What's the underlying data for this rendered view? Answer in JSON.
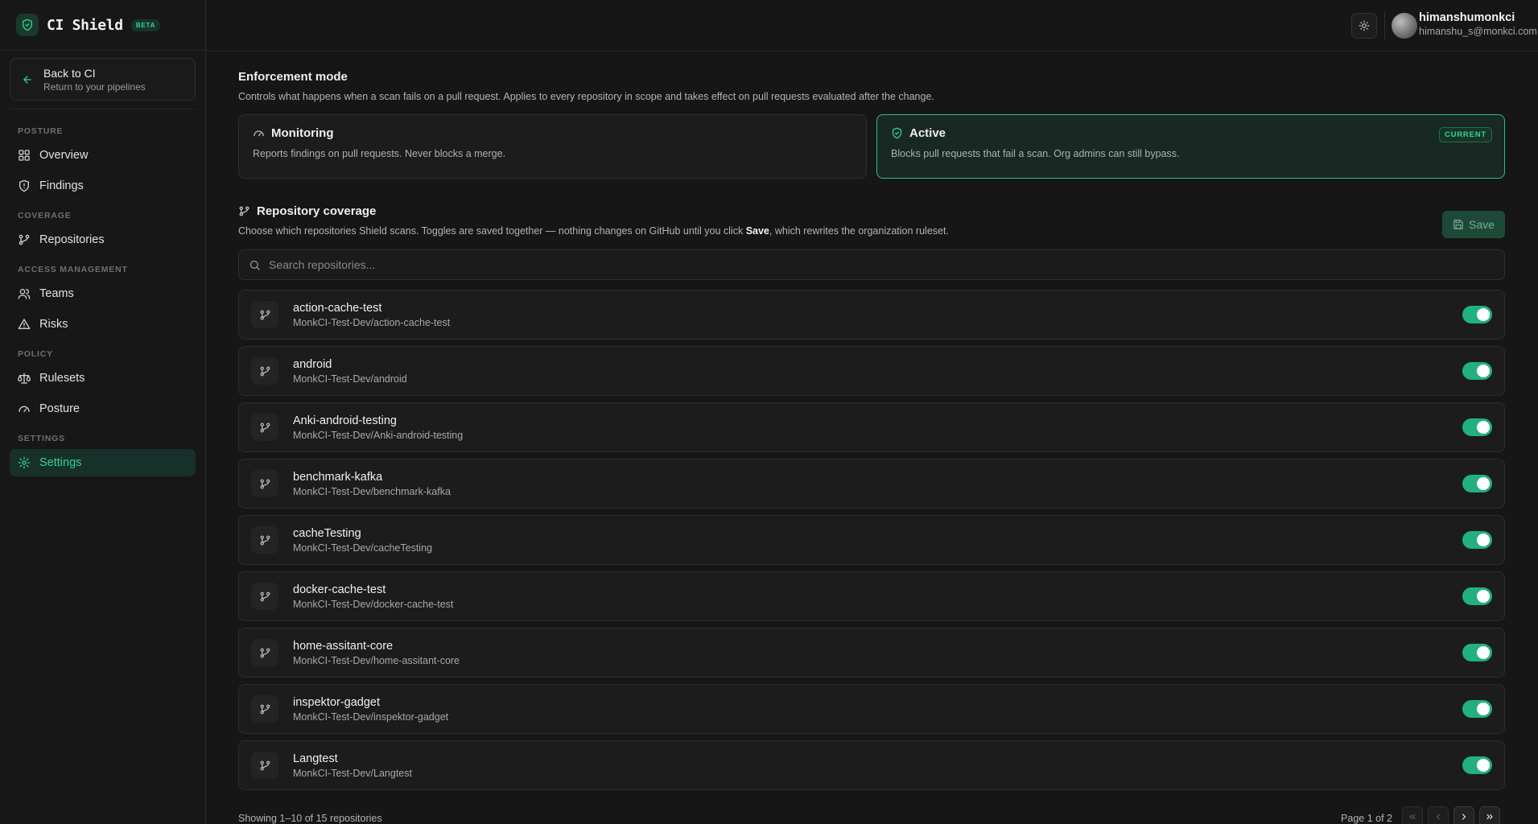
{
  "app": {
    "name": "CI Shield",
    "badge": "BETA"
  },
  "sidebar": {
    "back": {
      "title": "Back to CI",
      "subtitle": "Return to your pipelines"
    },
    "sections": {
      "posture": "POSTURE",
      "coverage": "COVERAGE",
      "access": "ACCESS MANAGEMENT",
      "policy": "POLICY",
      "settings": "SETTINGS"
    },
    "items": {
      "overview": "Overview",
      "findings": "Findings",
      "repositories": "Repositories",
      "teams": "Teams",
      "risks": "Risks",
      "rulesets": "Rulesets",
      "posture": "Posture",
      "settings": "Settings"
    },
    "active_item": "Settings"
  },
  "header": {
    "user_name": "himanshumonkci",
    "user_email": "himanshu_s@monkci.com"
  },
  "enforcement": {
    "title": "Enforcement mode",
    "description": "Controls what happens when a scan fails on a pull request. Applies to every repository in scope and takes effect on pull requests evaluated after the change.",
    "monitoring": {
      "name": "Monitoring",
      "description": "Reports findings on pull requests. Never blocks a merge."
    },
    "active": {
      "name": "Active",
      "description": "Blocks pull requests that fail a scan. Org admins can still bypass.",
      "badge": "CURRENT"
    },
    "current_mode": "Active"
  },
  "coverage": {
    "title": "Repository coverage",
    "description_pre": "Choose which repositories Shield scans. Toggles are saved together — nothing changes on GitHub until you click ",
    "description_bold": "Save",
    "description_post": ", which rewrites the organization ruleset.",
    "save_label": "Save",
    "search_placeholder": "Search repositories...",
    "repos": [
      {
        "name": "action-cache-test",
        "path": "MonkCI-Test-Dev/action-cache-test",
        "enabled": true
      },
      {
        "name": "android",
        "path": "MonkCI-Test-Dev/android",
        "enabled": true
      },
      {
        "name": "Anki-android-testing",
        "path": "MonkCI-Test-Dev/Anki-android-testing",
        "enabled": true
      },
      {
        "name": "benchmark-kafka",
        "path": "MonkCI-Test-Dev/benchmark-kafka",
        "enabled": true
      },
      {
        "name": "cacheTesting",
        "path": "MonkCI-Test-Dev/cacheTesting",
        "enabled": true
      },
      {
        "name": "docker-cache-test",
        "path": "MonkCI-Test-Dev/docker-cache-test",
        "enabled": true
      },
      {
        "name": "home-assitant-core",
        "path": "MonkCI-Test-Dev/home-assitant-core",
        "enabled": true
      },
      {
        "name": "inspektor-gadget",
        "path": "MonkCI-Test-Dev/inspektor-gadget",
        "enabled": true
      },
      {
        "name": "Langtest",
        "path": "MonkCI-Test-Dev/Langtest",
        "enabled": true
      }
    ],
    "showing": "Showing 1–10 of 15 repositories",
    "page_info": "Page 1 of 2"
  },
  "colors": {
    "accent": "#34d399",
    "toggle_on": "#22b07c",
    "background": "#161616"
  },
  "icons": {
    "brand": "shield-check-icon",
    "back": "arrow-left-icon",
    "overview": "grid-icon",
    "findings": "shield-icon",
    "repositories": "git-branch-icon",
    "teams": "users-icon",
    "risks": "alert-triangle-icon",
    "rulesets": "scale-icon",
    "posture": "gauge-icon",
    "settings": "gear-icon",
    "theme": "sun-icon",
    "save": "save-icon",
    "search": "search-icon"
  }
}
